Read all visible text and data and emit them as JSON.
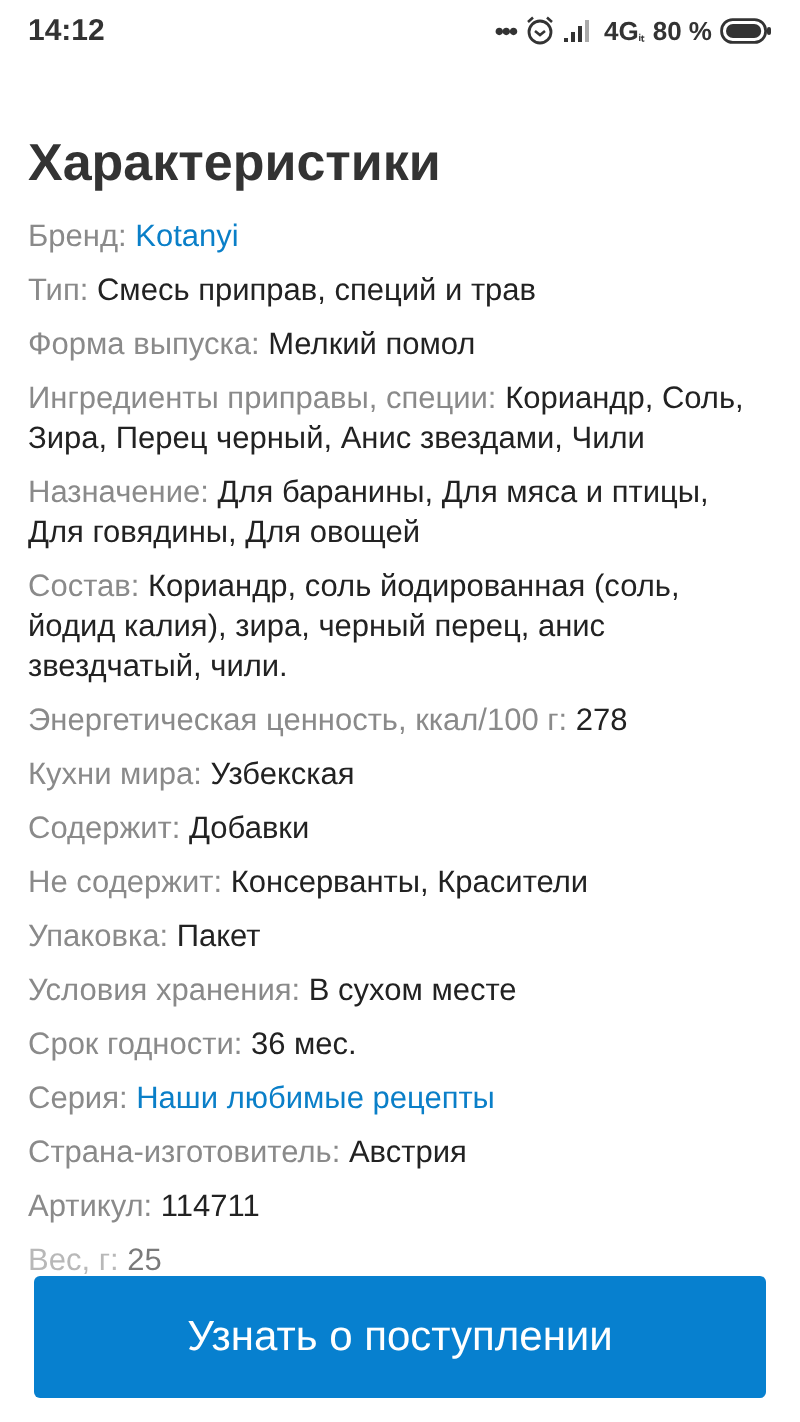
{
  "status_bar": {
    "time": "14:12",
    "more": "•••",
    "network": "4G",
    "network_sub": "ᵢₜ",
    "battery": "80 %"
  },
  "title": "Характеристики",
  "specs": [
    {
      "label": "Бренд:",
      "value": "Kotanyi",
      "kind": "link"
    },
    {
      "label": "Тип:",
      "value": "Смесь приправ, специй и трав",
      "kind": "text"
    },
    {
      "label": "Форма выпуска:",
      "value": "Мелкий помол",
      "kind": "text"
    },
    {
      "label": "Ингредиенты приправы, специи:",
      "value": "Кориандр, Соль, Зира, Перец черный, Анис звездами, Чили",
      "kind": "text"
    },
    {
      "label": "Назначение:",
      "value": "Для баранины, Для мяса и птицы, Для говядины, Для овощей",
      "kind": "text"
    },
    {
      "label": "Состав:",
      "value": "Кориандр, соль йодированная (соль, йодид калия), зира, черный перец, анис звездчатый, чили.",
      "kind": "text"
    },
    {
      "label": "Энергетическая ценность, ккал/100 г:",
      "value": "278",
      "kind": "text"
    },
    {
      "label": "Кухни мира:",
      "value": "Узбекская",
      "kind": "text"
    },
    {
      "label": "Содержит:",
      "value": "Добавки",
      "kind": "text"
    },
    {
      "label": "Не содержит:",
      "value": "Консерванты, Красители",
      "kind": "text"
    },
    {
      "label": "Упаковка:",
      "value": "Пакет",
      "kind": "text"
    },
    {
      "label": "Условия хранения:",
      "value": "В сухом месте",
      "kind": "text"
    },
    {
      "label": "Срок годности:",
      "value": "36 мес.",
      "kind": "text"
    },
    {
      "label": "Серия:",
      "value": "Наши любимые рецепты",
      "kind": "link"
    },
    {
      "label": "Страна-изготовитель:",
      "value": "Австрия",
      "kind": "text"
    },
    {
      "label": "Артикул:",
      "value": "114711",
      "kind": "text"
    },
    {
      "label": "Вес, г:",
      "value": "25",
      "kind": "faded"
    }
  ],
  "button": "Узнать о поступлении"
}
